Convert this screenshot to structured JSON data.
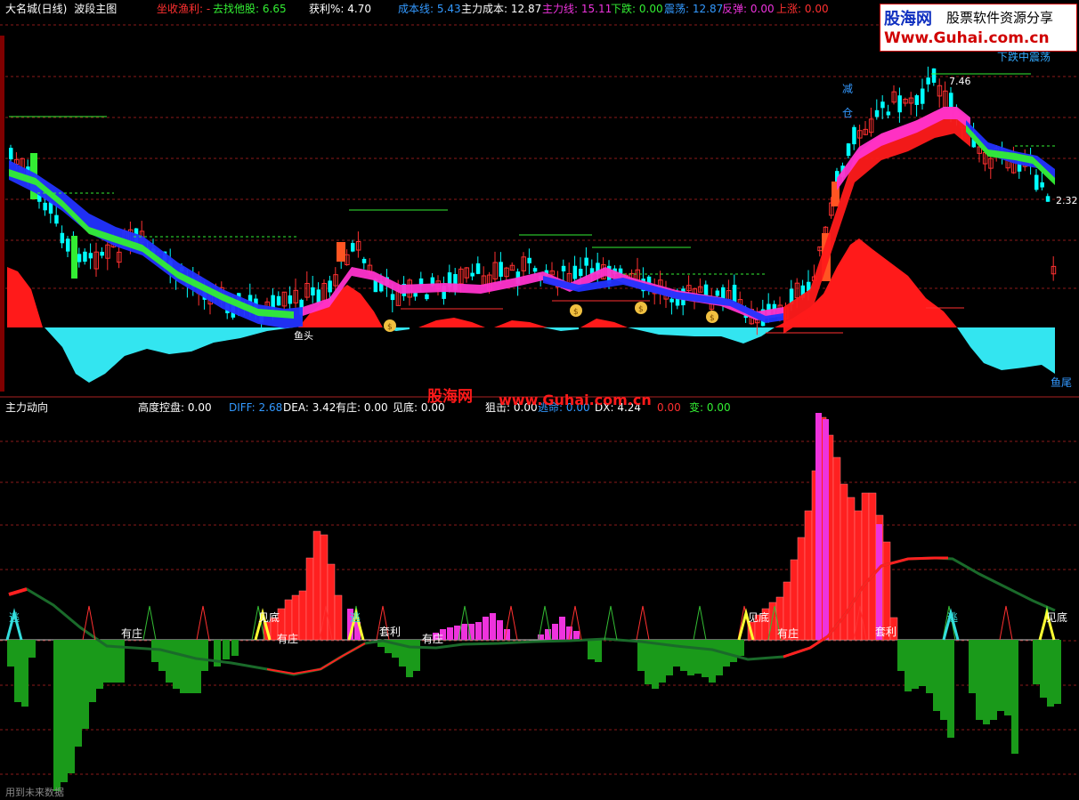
{
  "colors": {
    "bg": "#000000",
    "grid": "#8b1a1a",
    "up": "#ff3030",
    "down": "#00ffff",
    "ma_green": "#33ee33",
    "ma_blue": "#2233ff",
    "ma_magenta": "#ff33cc",
    "bull_area": "#ff1a1a",
    "bear_area": "#33e5f0",
    "bar_red": "#ff2020",
    "bar_green": "#1a9a1a",
    "bar_pink": "#ee33dd"
  },
  "top_header": {
    "title": "大名城(日线)",
    "indicator": "波段主图",
    "hold_label": "坐收渔利:",
    "hold_value": "-",
    "other_label": "去找他股:",
    "other_value": "6.65",
    "profit_label": "获利%:",
    "profit_value": "4.70",
    "cost_label": "成本线:",
    "cost_value": "5.43",
    "main_cost_label": "主力成本:",
    "main_cost_value": "12.87",
    "main_line_label": "主力线:",
    "main_line_value": "15.11",
    "fall_label": "下跌:",
    "fall_value": "0.00",
    "shake_label": "震荡:",
    "shake_value": "12.87",
    "rebound_label": "反弹:",
    "rebound_value": "0.00",
    "rise_label": "上涨:",
    "rise_value": "0.00"
  },
  "top_annotations": {
    "trend": "下跌中震荡",
    "high_price": "7.46",
    "low_price": "2.32",
    "reduce_1": "减",
    "reduce_2": "仓",
    "fish_head": "鱼头",
    "fish_tail": "鱼尾",
    "money_glyph": "$"
  },
  "bottom_header": {
    "title": "主力动向",
    "control_label": "高度控盘:",
    "control_value": "0.00",
    "diff_label": "DIFF:",
    "diff_value": "2.68",
    "dea_label": "DEA:",
    "dea_value": "3.42",
    "dealer_label": "有庄:",
    "dealer_value": "0.00",
    "bottom_label": "见底:",
    "bottom_value": "0.00",
    "block_label": "狙击:",
    "block_value": "0.00",
    "escape_label": "逃命:",
    "escape_value": "0.00",
    "dx_label": "DX:",
    "dx_value": "4.24",
    "other_value": "0.00",
    "change_label": "变:",
    "change_value": "0.00"
  },
  "bottom_annotations": {
    "escape": "逃",
    "bottom": "见底",
    "dealer": "有庄",
    "arbitrage": "套利"
  },
  "footer": "用到未来数据",
  "watermarks": {
    "center_cn": "股海网",
    "center_url": "www.Guhai.com.cn",
    "logo_name": "股海网",
    "logo_slogan": "股票软件资源分享",
    "logo_url": "Www.Guhai.com.cn"
  }
}
